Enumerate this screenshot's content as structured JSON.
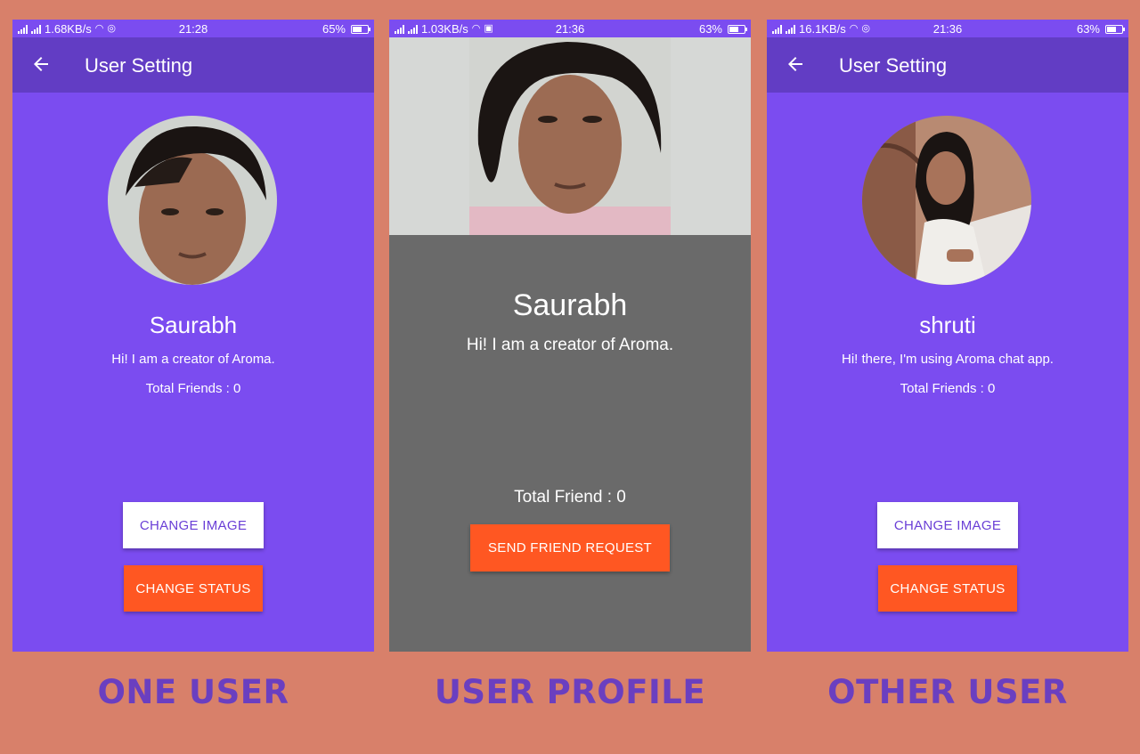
{
  "screens": [
    {
      "status_bar": {
        "speed": "1.68KB/s",
        "time": "21:28",
        "battery": "65%",
        "battery_level": 0.65
      },
      "appbar_title": "User Setting",
      "name": "Saurabh",
      "status": "Hi! I am a creator of Aroma.",
      "friends": "Total Friends : 0",
      "change_image_label": "CHANGE IMAGE",
      "change_status_label": "CHANGE STATUS"
    },
    {
      "status_bar": {
        "speed": "1.03KB/s",
        "time": "21:36",
        "battery": "63%",
        "battery_level": 0.63
      },
      "name": "Saurabh",
      "status": "Hi! I am a creator of Aroma.",
      "friends": "Total Friend : 0",
      "send_request_label": "SEND FRIEND REQUEST"
    },
    {
      "status_bar": {
        "speed": "16.1KB/s",
        "time": "21:36",
        "battery": "63%",
        "battery_level": 0.63
      },
      "appbar_title": "User Setting",
      "name": "shruti",
      "status": "Hi! there, I'm using Aroma chat app.",
      "friends": "Total Friends : 0",
      "change_image_label": "CHANGE IMAGE",
      "change_status_label": "CHANGE STATUS"
    }
  ],
  "captions": [
    "ONE USER",
    "USER PROFILE",
    "OTHER USER"
  ],
  "colors": {
    "page_background": "#d8806a",
    "primary": "#7b4cf0",
    "primary_dark": "#623dc4",
    "accent": "#ff5722",
    "profile_background": "#6a6a6a",
    "caption": "#6a3fc0"
  }
}
